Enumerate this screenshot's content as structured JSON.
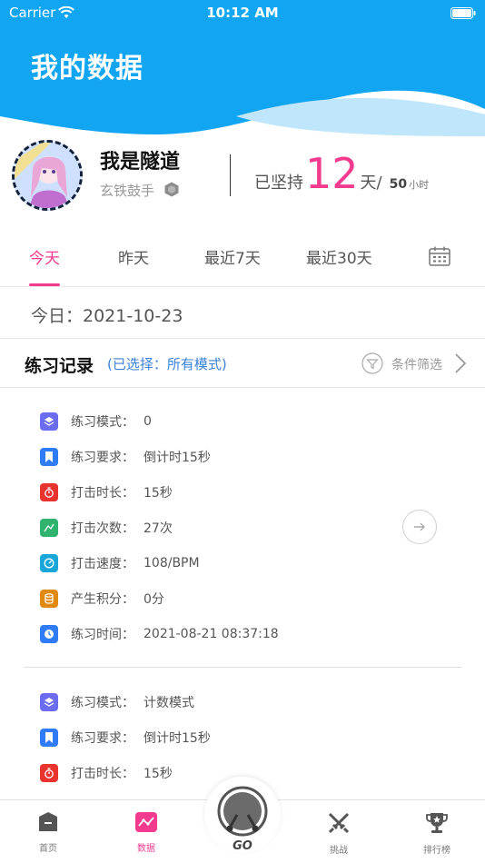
{
  "status_bar": {
    "carrier": "Carrier",
    "time": "10:12 AM"
  },
  "header": {
    "title": "我的数据"
  },
  "colors": {
    "accent": "#f23b8f",
    "header_blue": "#12a6f2",
    "link_blue": "#3b82d8"
  },
  "profile": {
    "username": "我是隧道",
    "rank": "玄铁鼓手",
    "persist_label": "已坚持",
    "days": "12",
    "days_unit": "天/",
    "hours": "50",
    "hours_unit": "小时"
  },
  "tabs": [
    {
      "label": "今天",
      "active": true
    },
    {
      "label": "昨天",
      "active": false
    },
    {
      "label": "最近7天",
      "active": false
    },
    {
      "label": "最近30天",
      "active": false
    }
  ],
  "today_line": "今日：2021-10-23",
  "records_header": {
    "title": "练习记录",
    "selected": "(已选择：所有模式)",
    "filter_label": "条件筛选"
  },
  "records": [
    {
      "rows": [
        {
          "icon": "layers-icon",
          "label": "练习模式：",
          "value": "0"
        },
        {
          "icon": "bookmark-icon",
          "label": "练习要求：",
          "value": "倒计时15秒"
        },
        {
          "icon": "stopwatch-icon",
          "label": "打击时长：",
          "value": "15秒"
        },
        {
          "icon": "chart-line-icon",
          "label": "打击次数：",
          "value": "27次"
        },
        {
          "icon": "speedometer-icon",
          "label": "打击速度：",
          "value": "108/BPM"
        },
        {
          "icon": "coins-icon",
          "label": "产生积分：",
          "value": "0分"
        },
        {
          "icon": "clock-icon",
          "label": "练习时间：",
          "value": "2021-08-21 08:37:18"
        }
      ]
    },
    {
      "rows": [
        {
          "icon": "layers-icon",
          "label": "练习模式：",
          "value": "计数模式"
        },
        {
          "icon": "bookmark-icon",
          "label": "练习要求：",
          "value": "倒计时15秒"
        },
        {
          "icon": "stopwatch-icon",
          "label": "打击时长：",
          "value": "15秒"
        }
      ]
    }
  ],
  "bottom_nav": {
    "home": "首页",
    "data": "数据",
    "challenge": "挑战",
    "ranking": "排行榜"
  }
}
